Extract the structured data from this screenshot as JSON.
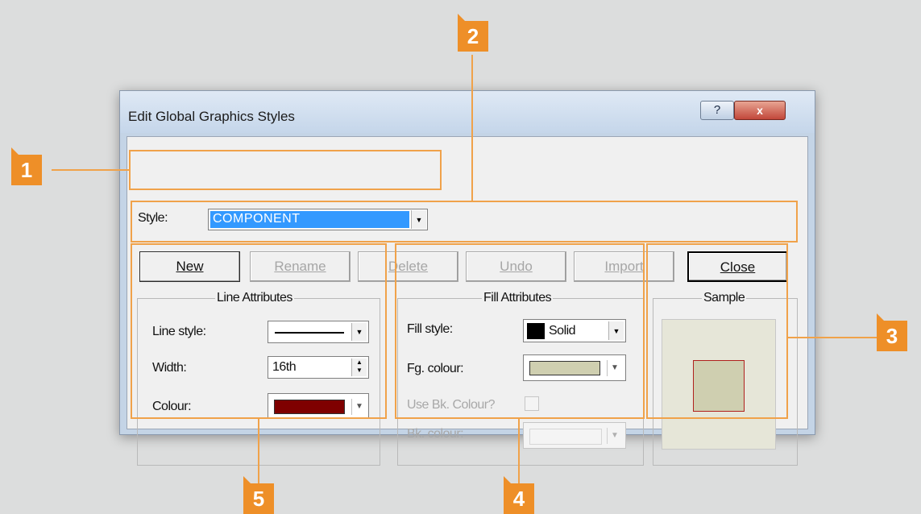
{
  "window": {
    "title": "Edit Global Graphics Styles",
    "help_label": "?",
    "close_label": "x"
  },
  "style_row": {
    "label": "Style:",
    "value": "COMPONENT"
  },
  "buttons": {
    "new": "New",
    "rename": "Rename",
    "delete": "Delete",
    "undo": "Undo",
    "import": "Import",
    "close": "Close"
  },
  "line_attributes": {
    "title": "Line Attributes",
    "line_style_label": "Line style:",
    "width_label": "Width:",
    "width_value": "16th",
    "colour_label": "Colour:",
    "colour_value": "#7f0000"
  },
  "fill_attributes": {
    "title": "Fill Attributes",
    "fill_style_label": "Fill style:",
    "fill_style_value": "Solid",
    "fg_colour_label": "Fg. colour:",
    "fg_colour_value": "#cfcfb0",
    "use_bk_label": "Use Bk. Colour?",
    "bk_colour_label": "Bk. colour:"
  },
  "sample": {
    "title": "Sample",
    "background": "#e6e6d8",
    "fill": "#cfcfb0",
    "border": "#b0201d"
  },
  "callouts": {
    "one": "1",
    "two": "2",
    "three": "3",
    "four": "4",
    "five": "5"
  },
  "accent_color": "#ee8f28"
}
